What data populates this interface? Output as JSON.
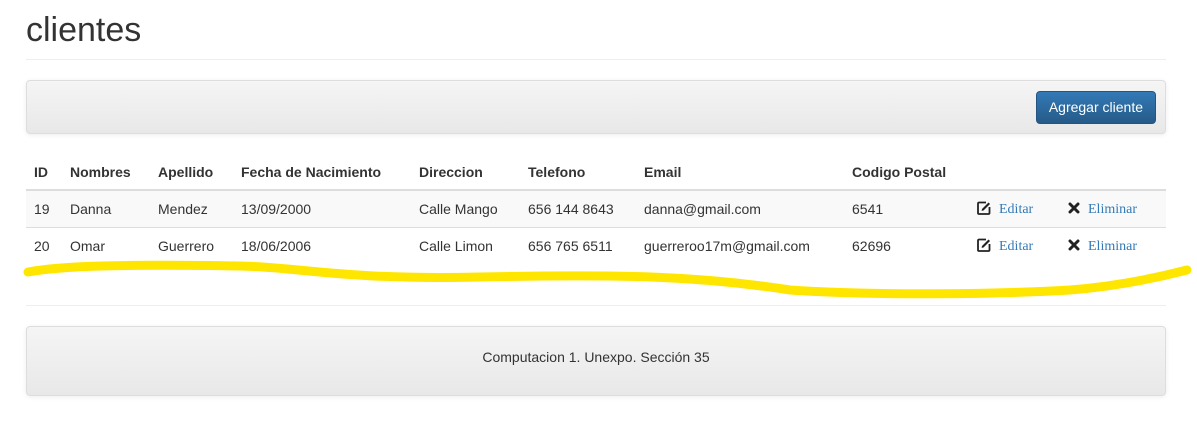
{
  "page": {
    "title": "clientes"
  },
  "toolbar": {
    "add_label": "Agregar cliente",
    "button_color": "#337ab7"
  },
  "table": {
    "headers": [
      "ID",
      "Nombres",
      "Apellido",
      "Fecha de Nacimiento",
      "Direccion",
      "Telefono",
      "Email",
      "Codigo Postal"
    ],
    "rows": [
      {
        "id": "19",
        "nombres": "Danna",
        "apellido": "Mendez",
        "fecha": "13/09/2000",
        "direccion": "Calle Mango",
        "telefono": "656 144 8643",
        "email": "danna@gmail.com",
        "codigo_postal": "6541",
        "edit_label": "Editar",
        "delete_label": "Eliminar"
      },
      {
        "id": "20",
        "nombres": "Omar",
        "apellido": "Guerrero",
        "fecha": "18/06/2006",
        "direccion": "Calle Limon",
        "telefono": "656 765 6511",
        "email": "guerreroo17m@gmail.com",
        "codigo_postal": "62696",
        "edit_label": "Editar",
        "delete_label": "Eliminar"
      }
    ],
    "edit_icon": "edit-icon",
    "delete_icon": "close-icon"
  },
  "annotation": {
    "stroke_color": "#ffe600"
  },
  "footer": {
    "text": "Computacion 1. Unexpo. Sección 35"
  }
}
